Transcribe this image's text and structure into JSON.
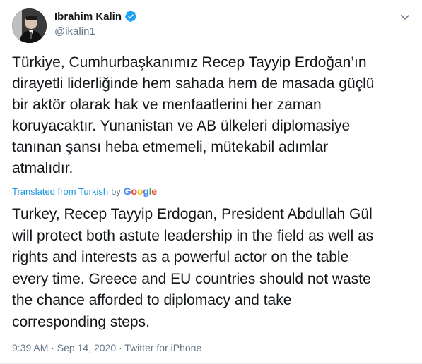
{
  "author": {
    "display_name": "Ibrahim Kalin",
    "handle": "@ikalin1",
    "verified": true,
    "avatar_icon": "avatar-photo-icon"
  },
  "tweet": {
    "original_text": "Türkiye, Cumhurbaşkanımız Recep Tayyip Erdoğan’ın\ndirayetli liderliğinde hem sahada hem de masada güçlü\nbir aktör olarak hak ve menfaatlerini her zaman\nkoruyacaktır. Yunanistan ve AB ülkeleri diplomasiye\ntanınan şansı heba etmemeli, mütekabil adımlar\natmalıdır.",
    "translated_from_label": "Translated from Turkish",
    "by_label": "by",
    "google_logo": "Google",
    "translated_text": "Turkey, Recep Tayyip Erdogan, President Abdullah Gül\nwill protect both astute leadership in the field as well as\nrights and interests as a powerful actor on the table\nevery time. Greece and EU countries should not waste\nthe chance afforded to diplomacy and take\ncorresponding steps.",
    "meta": "9:39 AM · Sep 14, 2020 · Twitter for iPhone"
  },
  "colors": {
    "link": "#1b95e0",
    "secondary_text": "#657786",
    "primary_text": "#14171a",
    "verified_badge": "#1da1f2"
  }
}
